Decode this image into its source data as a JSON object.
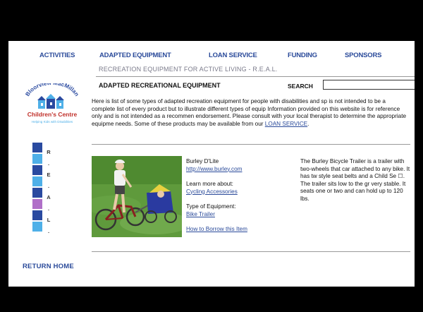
{
  "nav": {
    "activities": "ACTIVITIES",
    "adapted_equipment": "ADAPTED EQUIPMENT",
    "loan_service": "LOAN SERVICE",
    "funding": "FUNDING",
    "sponsors": "SPONSORS"
  },
  "subtitle": "RECREATION EQUIPMENT FOR ACTIVE LIVING - R.E.A.L.",
  "section_heading": "ADAPTED RECREATIONAL EQUIPMENT",
  "search": {
    "label": "SEARCH",
    "value": ""
  },
  "intro": {
    "text": "Here is list of some types of adapted recreation equipment for people with disabilities and sp is not intended to be a complete list of every product but to illustrate different types of equip Information provided on this website is for reference only and is not intended as a recommen endorsement. Please consult with your local therapist to determine the appropriate equipme needs. Some of these products may be available from our",
    "link": "LOAN SERVICE",
    "end": "."
  },
  "logo": {
    "arc_text": "Bloorview MacMillan",
    "name": "Children's Centre",
    "tagline": "Helping Kids with Disabilities"
  },
  "side_letters": [
    "R",
    ".",
    "E",
    ".",
    "A",
    ".",
    "L",
    "."
  ],
  "side_colors": [
    "#2a4aa0",
    "#4fb0e8",
    "#2a4aa0",
    "#4fb0e8",
    "#2a4aa0",
    "#b070c8",
    "#2a4aa0",
    "#4fb0e8"
  ],
  "item": {
    "name": "Burley D'Lite",
    "url": "http://www.burley.com",
    "learn_label": "Learn more about:",
    "learn_link": "Cycling Accessories",
    "type_label": "Type of Equipment:",
    "type_link": "Bike Trailer",
    "borrow_link": "How to Borrow this Item",
    "description": "The Burley Bicycle Trailer is a trailer with two-wheels that car attached to any bike. It has tw style seat belts and a Child Se ☐. The trailer sits low to the gr very stable. It seats one or two and can hold up to 120 lbs."
  },
  "return_home": "RETURN HOME",
  "colors": {
    "link": "#2a4a9a",
    "frame": "#000000"
  }
}
